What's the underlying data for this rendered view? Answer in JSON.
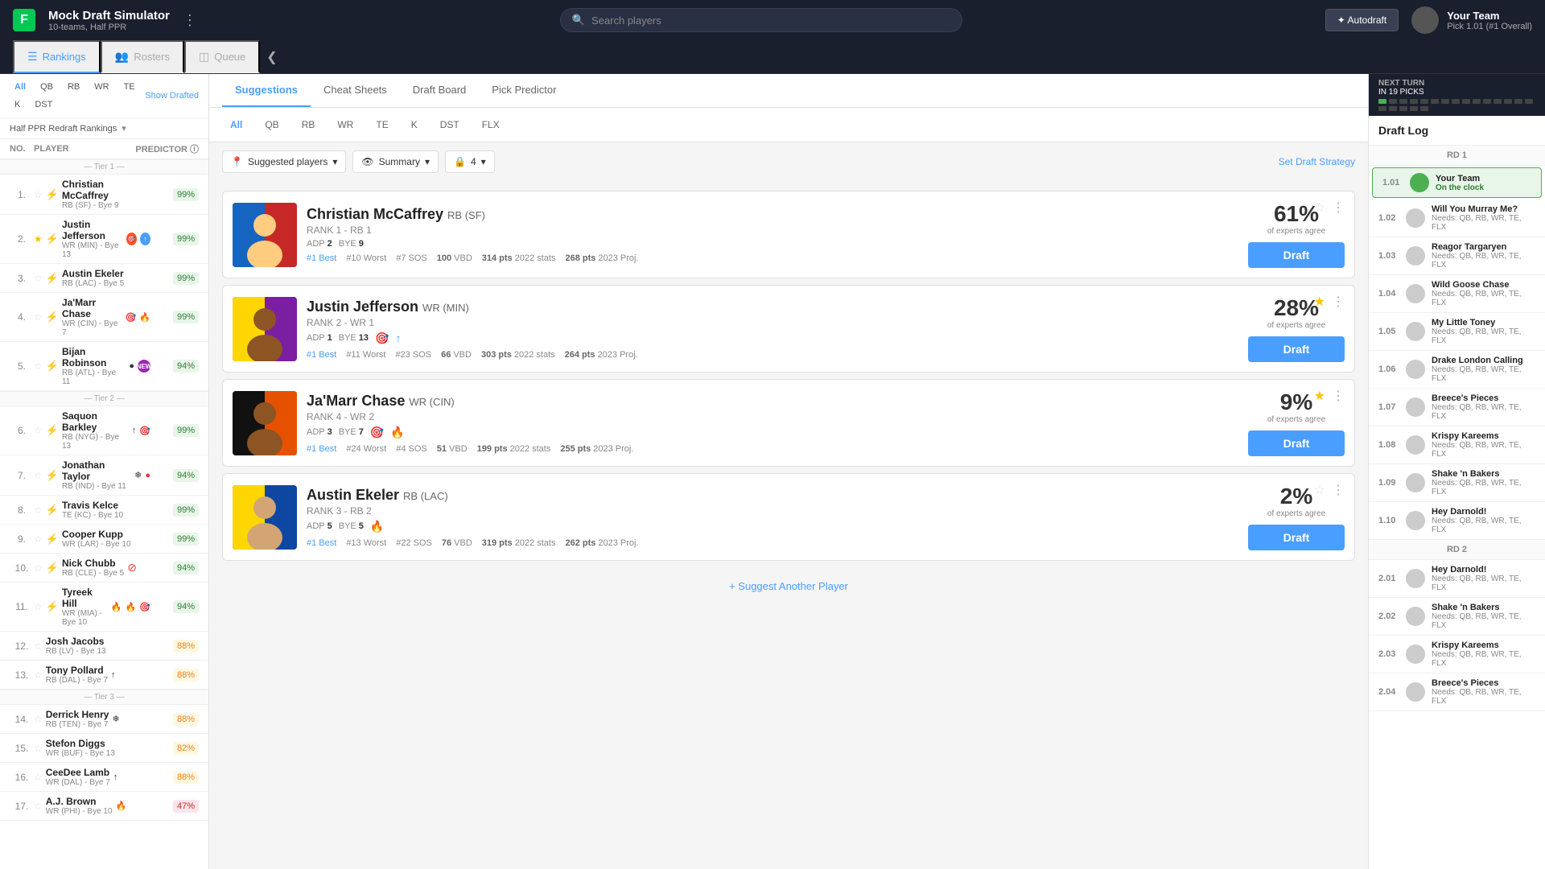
{
  "app": {
    "logo": "F",
    "title": "Mock Draft Simulator",
    "subtitle": "10-teams, Half PPR",
    "menu_icon": "⋮",
    "search_placeholder": "Search players",
    "autodraft_label": "✦ Autodraft",
    "your_team": {
      "name": "Your Team",
      "pick": "Pick 1.01 (#1 Overall)",
      "avatar_placeholder": "👤"
    }
  },
  "nav_tabs": [
    {
      "id": "rankings",
      "label": "Rankings",
      "icon": "☰",
      "active": true
    },
    {
      "id": "rosters",
      "label": "Rosters",
      "icon": "👥",
      "active": false
    },
    {
      "id": "queue",
      "label": "Queue",
      "icon": "◫",
      "active": false
    }
  ],
  "content_tabs": [
    {
      "id": "suggestions",
      "label": "Suggestions",
      "active": true
    },
    {
      "id": "cheat-sheets",
      "label": "Cheat Sheets",
      "active": false
    },
    {
      "id": "draft-board",
      "label": "Draft Board",
      "active": false
    },
    {
      "id": "pick-predictor",
      "label": "Pick Predictor",
      "active": false
    }
  ],
  "sidebar": {
    "positions": [
      "All",
      "QB",
      "RB",
      "WR",
      "TE",
      "K",
      "DST"
    ],
    "active_position": "All",
    "show_drafted_label": "Show Drafted",
    "rankings_filter": "Half PPR Redraft Rankings",
    "col_headers": {
      "no": "NO.",
      "player": "PLAYER",
      "predictor": "PREDICTOR ⓘ"
    },
    "tiers": [
      {
        "tier_label": "— Tier 1 —",
        "players": [
          {
            "num": 1,
            "name": "Christian McCaffrey",
            "pos": "RB (SF)",
            "bye": "Bye 9",
            "score": 99,
            "score_class": "green",
            "starred": false
          },
          {
            "num": 2,
            "name": "Justin Jefferson",
            "pos": "WR (MIN)",
            "bye": "Bye 13",
            "score": 99,
            "score_class": "green",
            "starred": true,
            "badges": [
              "target",
              "trend"
            ]
          },
          {
            "num": 3,
            "name": "Austin Ekeler",
            "pos": "RB (LAC)",
            "bye": "Bye 5",
            "score": 99,
            "score_class": "green",
            "starred": false
          },
          {
            "num": 4,
            "name": "Ja'Marr Chase",
            "pos": "WR (CIN)",
            "bye": "Bye 7",
            "score": 99,
            "score_class": "green",
            "starred": false,
            "badges": [
              "target",
              "flame"
            ]
          },
          {
            "num": 5,
            "name": "Bijan Robinson",
            "pos": "RB (ATL)",
            "bye": "Bye 11",
            "score": 94,
            "score_class": "green",
            "starred": false,
            "badges": [
              "dot",
              "new"
            ]
          }
        ]
      },
      {
        "tier_label": "— Tier 2 —",
        "players": [
          {
            "num": 6,
            "name": "Saquon Barkley",
            "pos": "RB (NYG)",
            "bye": "Bye 13",
            "score": 99,
            "score_class": "green",
            "starred": false,
            "badges": [
              "trend",
              "target"
            ]
          },
          {
            "num": 7,
            "name": "Jonathan Taylor",
            "pos": "RB (IND)",
            "bye": "Bye 11",
            "score": 94,
            "score_class": "green",
            "starred": false,
            "badges": [
              "snow",
              "dot"
            ]
          },
          {
            "num": 8,
            "name": "Travis Kelce",
            "pos": "TE (KC)",
            "bye": "Bye 10",
            "score": 99,
            "score_class": "green",
            "starred": false
          },
          {
            "num": 9,
            "name": "Cooper Kupp",
            "pos": "WR (LAR)",
            "bye": "Bye 10",
            "score": 99,
            "score_class": "green",
            "starred": false
          },
          {
            "num": 10,
            "name": "Nick Chubb",
            "pos": "RB (CLE)",
            "bye": "Bye 5",
            "score": 94,
            "score_class": "green",
            "starred": false,
            "badges": [
              "no"
            ]
          },
          {
            "num": 11,
            "name": "Tyreek Hill",
            "pos": "WR (MIA)",
            "bye": "Bye 10",
            "score": 94,
            "score_class": "green",
            "starred": false,
            "badges": [
              "flame",
              "flame",
              "target"
            ]
          },
          {
            "num": 12,
            "name": "Josh Jacobs",
            "pos": "RB (LV)",
            "bye": "Bye 13",
            "score": 88,
            "score_class": "yellow",
            "starred": false
          },
          {
            "num": 13,
            "name": "Tony Pollard",
            "pos": "RB (DAL)",
            "bye": "Bye 7",
            "score": 88,
            "score_class": "yellow",
            "starred": false,
            "badges": [
              "trend",
              "trend2"
            ]
          }
        ]
      },
      {
        "tier_label": "— Tier 3 —",
        "players": [
          {
            "num": 14,
            "name": "Derrick Henry",
            "pos": "RB (TEN)",
            "bye": "Bye 7",
            "score": 88,
            "score_class": "yellow",
            "starred": false,
            "badges": [
              "snow"
            ]
          },
          {
            "num": 15,
            "name": "Stefon Diggs",
            "pos": "WR (BUF)",
            "bye": "Bye 13",
            "score": 82,
            "score_class": "yellow",
            "starred": false
          },
          {
            "num": 16,
            "name": "CeeDee Lamb",
            "pos": "WR (DAL)",
            "bye": "Bye 7",
            "score": 88,
            "score_class": "yellow",
            "starred": false,
            "badges": [
              "trend"
            ]
          },
          {
            "num": 17,
            "name": "A.J. Brown",
            "pos": "WR (PHI)",
            "bye": "Bye 10",
            "score": 47,
            "score_class": "red",
            "starred": false,
            "badges": [
              "flame"
            ]
          }
        ]
      }
    ]
  },
  "main": {
    "position_filters": [
      "All",
      "QB",
      "RB",
      "WR",
      "TE",
      "K",
      "DST",
      "FLX"
    ],
    "active_filter": "All",
    "filter_suggested": "Suggested players",
    "filter_summary": "Summary",
    "filter_lock": "4",
    "set_strategy": "Set Draft Strategy",
    "players": [
      {
        "id": "mccaffrey",
        "name": "Christian McCaffrey",
        "pos": "RB (SF)",
        "rank_label": "RANK 1 - RB 1",
        "adp": "ADP 2",
        "bye": "BYE 9",
        "best": "#1 Best",
        "worst": "#10 Worst",
        "sos": "#7 SOS",
        "vbd": "100 VBD",
        "stats2022": "314 pts",
        "proj2023": "268 pts",
        "expert_pct": 61,
        "starred": false,
        "photo_class": "photo-mccaffrey",
        "photo_emoji": "🏃"
      },
      {
        "id": "jefferson",
        "name": "Justin Jefferson",
        "pos": "WR (MIN)",
        "rank_label": "RANK 2 - WR 1",
        "adp": "ADP 1",
        "bye": "BYE 13",
        "best": "#1 Best",
        "worst": "#11 Worst",
        "sos": "#23 SOS",
        "vbd": "66 VBD",
        "stats2022": "303 pts",
        "proj2023": "264 pts",
        "expert_pct": 28,
        "starred": true,
        "photo_class": "photo-jefferson",
        "photo_emoji": "🏈"
      },
      {
        "id": "chase",
        "name": "Ja'Marr Chase",
        "pos": "WR (CIN)",
        "rank_label": "RANK 4 - WR 2",
        "adp": "ADP 3",
        "bye": "BYE 7",
        "best": "#1 Best",
        "worst": "#24 Worst",
        "sos": "#4 SOS",
        "vbd": "51 VBD",
        "stats2022": "199 pts",
        "proj2023": "255 pts",
        "expert_pct": 9,
        "starred": true,
        "photo_class": "photo-chase",
        "photo_emoji": "⚡"
      },
      {
        "id": "ekeler",
        "name": "Austin Ekeler",
        "pos": "RB (LAC)",
        "rank_label": "RANK 3 - RB 2",
        "adp": "ADP 5",
        "bye": "BYE 5",
        "best": "#1 Best",
        "worst": "#13 Worst",
        "sos": "#22 SOS",
        "vbd": "76 VBD",
        "stats2022": "319 pts",
        "proj2023": "262 pts",
        "expert_pct": 2,
        "starred": false,
        "photo_class": "photo-ekeler",
        "photo_emoji": "🎯"
      }
    ],
    "suggest_another": "+ Suggest Another Player"
  },
  "right_sidebar": {
    "next_turn_label": "NEXT TURN",
    "next_turn_picks": "IN 19 PICKS",
    "draft_log_title": "Draft Log",
    "rounds": [
      {
        "rd_label": "RD 1",
        "picks": [
          {
            "num": "1.01",
            "team": "Your Team",
            "on_clock": true,
            "needs": "On the clock"
          },
          {
            "num": "1.02",
            "team": "Will You Murray Me?",
            "needs": "Needs: QB, RB, WR, TE, FLX"
          },
          {
            "num": "1.03",
            "team": "Reagor Targaryen",
            "needs": "Needs: QB, RB, WR, TE, FLX"
          },
          {
            "num": "1.04",
            "team": "Wild Goose Chase",
            "needs": "Needs: QB, RB, WR, TE, FLX"
          },
          {
            "num": "1.05",
            "team": "My Little Toney",
            "needs": "Needs: QB, RB, WR, TE, FLX"
          },
          {
            "num": "1.06",
            "team": "Drake London Calling",
            "needs": "Needs: QB, RB, WR, TE, FLX"
          },
          {
            "num": "1.07",
            "team": "Breece's Pieces",
            "needs": "Needs: QB, RB, WR, TE, FLX"
          },
          {
            "num": "1.08",
            "team": "Krispy Kareems",
            "needs": "Needs: QB, RB, WR, TE, FLX"
          },
          {
            "num": "1.09",
            "team": "Shake 'n Bakers",
            "needs": "Needs: QB, RB, WR, TE, FLX"
          },
          {
            "num": "1.10",
            "team": "Hey Darnold!",
            "needs": "Needs: QB, RB, WR, TE, FLX"
          }
        ]
      },
      {
        "rd_label": "RD 2",
        "picks": [
          {
            "num": "2.01",
            "team": "Hey Darnold!",
            "needs": "Needs: QB, RB, WR, TE, FLX"
          },
          {
            "num": "2.02",
            "team": "Shake 'n Bakers",
            "needs": "Needs: QB, RB, WR, TE, FLX"
          },
          {
            "num": "2.03",
            "team": "Krispy Kareems",
            "needs": "Needs: QB, RB, WR, TE, FLX"
          },
          {
            "num": "2.04",
            "team": "Breece's Pieces",
            "needs": "Needs: QB, RB, WR, TE, FLX"
          }
        ]
      }
    ]
  }
}
